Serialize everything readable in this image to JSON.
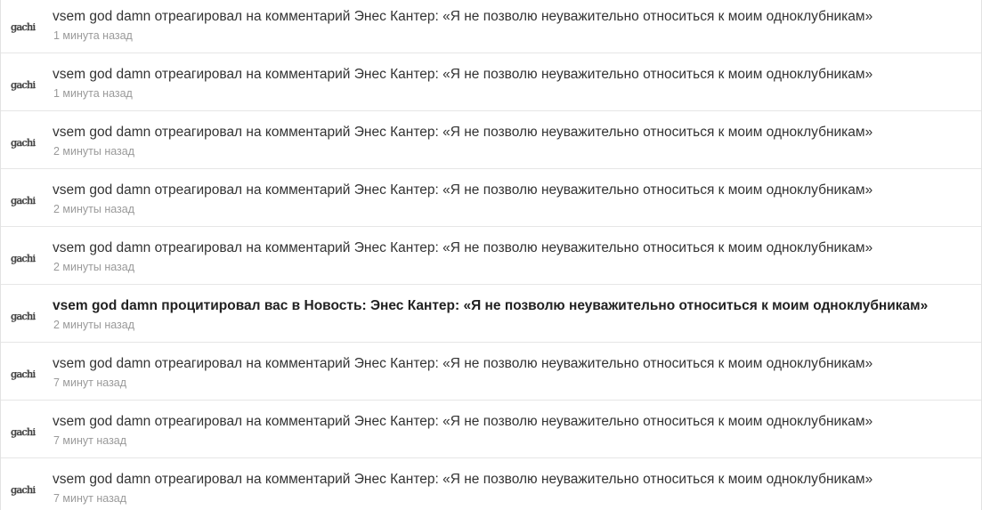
{
  "notifications": [
    {
      "avatar_text": "gachi",
      "title": "vsem god damn отреагировал на комментарий Энес Кантер: «Я не позволю неуважительно относиться к моим одноклубникам»",
      "time": "1 минута назад",
      "bold": false
    },
    {
      "avatar_text": "gachi",
      "title": "vsem god damn отреагировал на комментарий Энес Кантер: «Я не позволю неуважительно относиться к моим одноклубникам»",
      "time": "1 минута назад",
      "bold": false
    },
    {
      "avatar_text": "gachi",
      "title": "vsem god damn отреагировал на комментарий Энес Кантер: «Я не позволю неуважительно относиться к моим одноклубникам»",
      "time": "2 минуты назад",
      "bold": false
    },
    {
      "avatar_text": "gachi",
      "title": "vsem god damn отреагировал на комментарий Энес Кантер: «Я не позволю неуважительно относиться к моим одноклубникам»",
      "time": "2 минуты назад",
      "bold": false
    },
    {
      "avatar_text": "gachi",
      "title": "vsem god damn отреагировал на комментарий Энес Кантер: «Я не позволю неуважительно относиться к моим одноклубникам»",
      "time": "2 минуты назад",
      "bold": false
    },
    {
      "avatar_text": "gachi",
      "title": "vsem god damn процитировал вас в Новость: Энес Кантер: «Я не позволю неуважительно относиться к моим одноклубникам»",
      "time": "2 минуты назад",
      "bold": true
    },
    {
      "avatar_text": "gachi",
      "title": "vsem god damn отреагировал на комментарий Энес Кантер: «Я не позволю неуважительно относиться к моим одноклубникам»",
      "time": "7 минут назад",
      "bold": false
    },
    {
      "avatar_text": "gachi",
      "title": "vsem god damn отреагировал на комментарий Энес Кантер: «Я не позволю неуважительно относиться к моим одноклубникам»",
      "time": "7 минут назад",
      "bold": false
    },
    {
      "avatar_text": "gachi",
      "title": "vsem god damn отреагировал на комментарий Энес Кантер: «Я не позволю неуважительно относиться к моим одноклубникам»",
      "time": "7 минут назад",
      "bold": false
    }
  ]
}
